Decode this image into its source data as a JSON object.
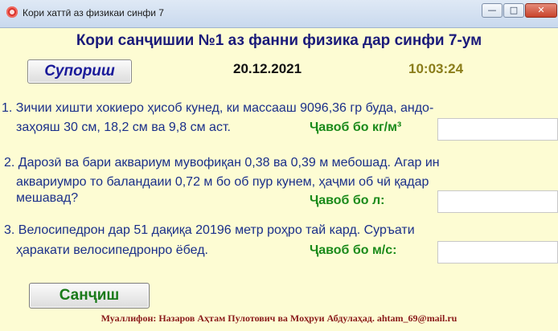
{
  "window": {
    "title": "Кори хаттӣ аз физикаи синфи 7",
    "controls": {
      "minimize": "—",
      "maximize": "□",
      "close": "✕"
    }
  },
  "header": {
    "title": "Кори санҷишии №1 аз фанни физика дар синфи 7-ум",
    "start_button": "Супориш",
    "date": "20.12.2021",
    "time": "10:03:24"
  },
  "questions": [
    {
      "line1": "1. Зичии хишти хокиеро ҳисоб кунед, ки массааш 9096,36     гр буда, андо-",
      "line2": "заҳояш 30    см,  18,2 см ва 9,8   см аст.",
      "answer_label": "Ҷавоб бо кг/м³",
      "answer_value": ""
    },
    {
      "line1": "2. Дарозӣ ва бари аквариум мувофиқан 0,38  ва 0,39  м мебошад. Агар ин",
      "line2": "аквариумро то баландаии  0,72 м   бо   об пур кунем, ҳаҷми об чӣ қадар",
      "line3": "мешавад?",
      "answer_label": "Ҷавоб бо л:",
      "answer_value": ""
    },
    {
      "line1": "3. Велосипедрон  дар 51   дақиқа  20196 метр роҳро  тай  кард. Суръати",
      "line2": "ҳаракати велосипедронро ёбед.",
      "answer_label": "Ҷавоб бо м/с:",
      "answer_value": ""
    }
  ],
  "check_button": "Санҷиш",
  "footer": "Муаллифон: Назаров Аҳтам Пулотович ва Моҳруи Абдулаҳад. ahtam_69@mail.ru"
}
